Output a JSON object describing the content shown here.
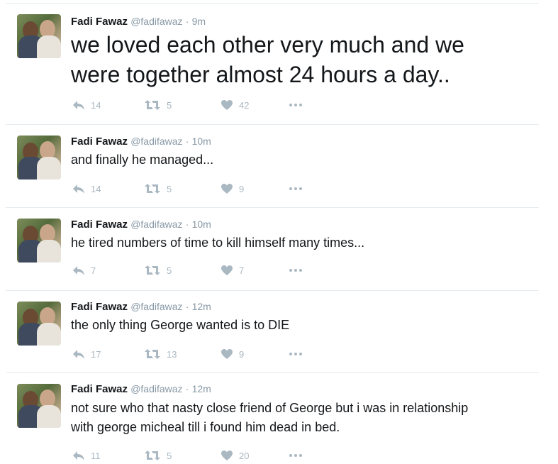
{
  "tweets": [
    {
      "name": "Fadi Fawaz",
      "handle": "@fadifawaz",
      "sep": "·",
      "time": "9m",
      "text_lines": [
        "we loved each other very much and we",
        "were together almost 24 hours a day.."
      ],
      "replies": "14",
      "retweets": "5",
      "likes": "42"
    },
    {
      "name": "Fadi Fawaz",
      "handle": "@fadifawaz",
      "sep": "·",
      "time": "10m",
      "text_lines": [
        "and finally he managed..."
      ],
      "replies": "14",
      "retweets": "5",
      "likes": "9"
    },
    {
      "name": "Fadi Fawaz",
      "handle": "@fadifawaz",
      "sep": "·",
      "time": "10m",
      "text_lines": [
        "he tired numbers of time to kill himself many times..."
      ],
      "replies": "7",
      "retweets": "5",
      "likes": "7"
    },
    {
      "name": "Fadi Fawaz",
      "handle": "@fadifawaz",
      "sep": "·",
      "time": "12m",
      "text_lines": [
        "the only thing George wanted is to DIE"
      ],
      "replies": "17",
      "retweets": "13",
      "likes": "9"
    },
    {
      "name": "Fadi Fawaz",
      "handle": "@fadifawaz",
      "sep": "·",
      "time": "12m",
      "text_lines": [
        "not sure who that nasty close friend of George but i was in relationship",
        "with george micheal till i found him dead in bed."
      ],
      "replies": "11",
      "retweets": "5",
      "likes": "20"
    }
  ],
  "icons": {
    "reply": "reply-icon",
    "retweet": "retweet-icon",
    "like": "heart-icon",
    "more": "more-dots-icon"
  },
  "colors": {
    "name": "#14171a",
    "meta": "#8899a6",
    "action": "#aab8c2",
    "divider": "#e6ecf0"
  }
}
